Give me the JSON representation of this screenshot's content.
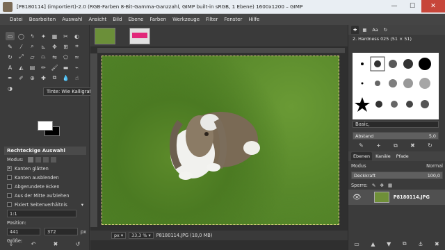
{
  "window": {
    "title": "[P8180114] (importiert)-2.0 (RGB-Farben 8-Bit-Gamma-Ganzzahl, GIMP built-in sRGB, 1 Ebene) 1600x1200 – GIMP",
    "minimize": "—",
    "maximize": "☐",
    "close": "✕"
  },
  "menu": [
    "Datei",
    "Bearbeiten",
    "Auswahl",
    "Ansicht",
    "Bild",
    "Ebene",
    "Farben",
    "Werkzeuge",
    "Filter",
    "Fenster",
    "Hilfe"
  ],
  "tooltip": "Tinte: Wie Kalligrafie zeichnen",
  "tool_options": {
    "title": "Rechteckige Auswahl",
    "modus_label": "Modus:",
    "options": [
      "Kanten glätten",
      "Kanten ausblenden",
      "Abgerundete Ecken",
      "Aus der Mitte aufziehen"
    ],
    "option_checked": [
      true,
      false,
      false,
      false
    ],
    "fixiert": "Fixiert  Seitenverhältnis",
    "ratio": "1:1",
    "position_label": "Position:",
    "unit": "px",
    "pos_x": "441",
    "pos_y": "372",
    "size_label": "Größe:",
    "size_unit": "px"
  },
  "statusbar": {
    "unit": "px",
    "zoom": "33,3 %",
    "file": "P8180114.JPG (18,0 MB)"
  },
  "brushes": {
    "title": "2. Hardness 025 (51 × 51)",
    "preset": "Basic,",
    "abstand_label": "Abstand",
    "abstand_value": "5,0"
  },
  "layers": {
    "tabs": [
      "Ebenen",
      "Kanäle",
      "Pfade"
    ],
    "modus_label": "Modus",
    "modus_value": "Normal",
    "deckkraft_label": "Deckkraft",
    "deckkraft_value": "100,0",
    "sperre_label": "Sperre:",
    "layer_name": "P8180114.JPG"
  }
}
